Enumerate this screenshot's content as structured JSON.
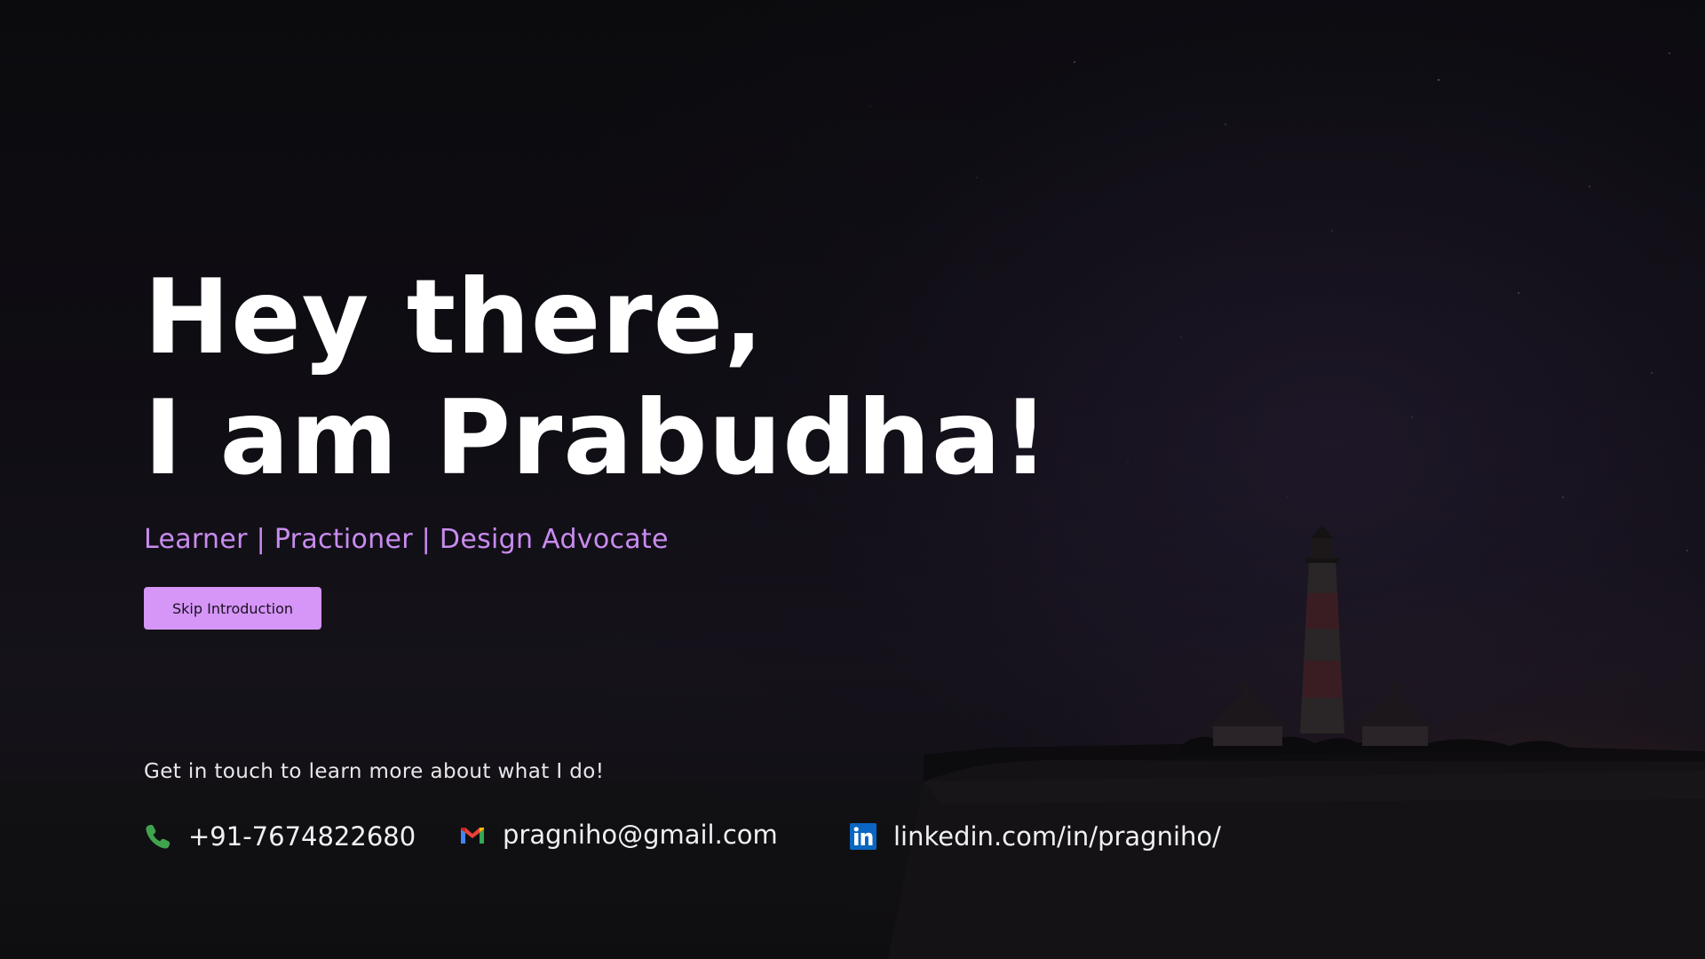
{
  "hero": {
    "headline_line1": "Hey there,",
    "headline_line2": "I am Prabudha!",
    "tagline": "Learner | Practioner | Design Advocate",
    "skip_button_label": "Skip Introduction"
  },
  "contact": {
    "intro": "Get in touch to learn more about what I do!",
    "phone": {
      "label": "+91-7674822680",
      "icon": "phone-icon"
    },
    "email": {
      "label": "pragniho@gmail.com",
      "icon": "gmail-icon"
    },
    "linkedin": {
      "label": "linkedin.com/in/pragniho/",
      "icon": "linkedin-icon"
    }
  },
  "colors": {
    "accent": "#c98bf0",
    "button_bg": "#d596f7",
    "headline": "#ffffff",
    "background": "#0d0c10",
    "phone_icon": "#3fa34d",
    "linkedin_icon": "#0a66c2"
  }
}
